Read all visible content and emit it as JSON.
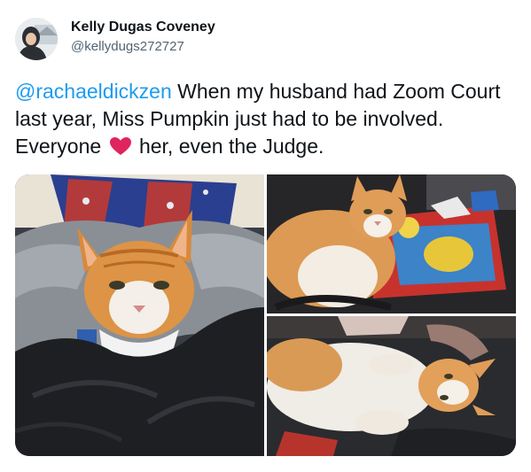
{
  "author": {
    "name": "Kelly Dugas Coveney",
    "handle": "@kellydugs272727"
  },
  "tweet": {
    "mention": "@rachaeldickzen",
    "text_part1": " When my husband had Zoom Court last year, Miss Pumpkin just had to be involved. Everyone ",
    "emoji": "red-heart",
    "text_part2": " her, even the Judge."
  },
  "colors": {
    "link": "#1d9bf0",
    "text": "#0f1419",
    "secondary_text": "#536471",
    "heart": "#e0245e"
  },
  "media": {
    "photo_count": 3,
    "photos": [
      {
        "subject": "orange-white-cat-wrapped-in-blankets"
      },
      {
        "subject": "orange-white-cat-on-colorful-play-mat"
      },
      {
        "subject": "orange-white-cat-lying-on-back"
      }
    ]
  }
}
